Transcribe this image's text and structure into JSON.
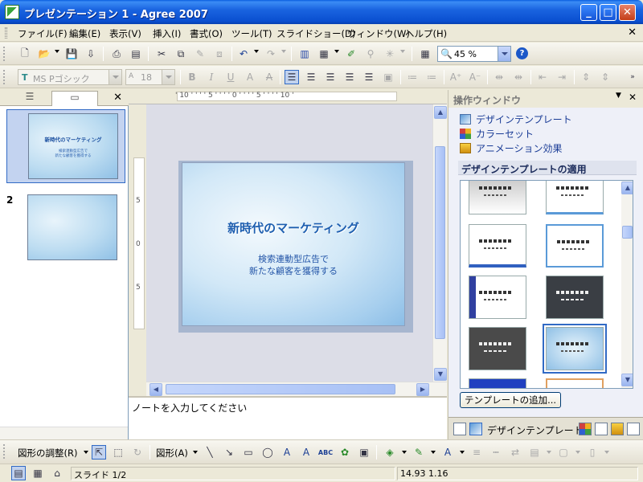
{
  "window": {
    "title": "プレゼンテーション 1 - Agree 2007"
  },
  "menu": {
    "items": [
      "ファイル(F)",
      "編集(E)",
      "表示(V)",
      "挿入(I)",
      "書式(O)",
      "ツール(T)",
      "スライドショー(D)",
      "ウィンドウ(W)",
      "ヘルプ(H)"
    ]
  },
  "toolbar": {
    "zoom": "45 %"
  },
  "format_toolbar": {
    "font_name": "MS Pゴシック",
    "font_size": "18"
  },
  "slide_panel": {
    "slides": [
      {
        "number": "1",
        "title": "新時代のマーケティング",
        "subtitle_line1": "検索連動型広告で",
        "subtitle_line2": "新たな顧客を獲得する"
      },
      {
        "number": "2"
      }
    ]
  },
  "editor": {
    "ruler_h": "' 10 ' ' ' ' 5 ' ' ' ' 0 ' ' ' ' 5 ' ' ' ' 10 '",
    "ruler_v": [
      "5",
      "0",
      "5"
    ],
    "slide": {
      "title": "新時代のマーケティング",
      "subtitle_line1": "検索連動型広告で",
      "subtitle_line2": "新たな顧客を獲得する"
    },
    "notes_placeholder": "ノートを入力してください"
  },
  "task_pane": {
    "title": "操作ウィンドウ",
    "links": [
      "デザインテンプレート",
      "カラーセット",
      "アニメーション効果"
    ],
    "section_title": "デザインテンプレートの適用",
    "add_template_button": "テンプレートの追加...",
    "bottom_label": "デザインテンプレート"
  },
  "draw_toolbar": {
    "adjust_label": "図形の調整(R)",
    "shapes_label": "図形(A)"
  },
  "status": {
    "slide_info": "スライド 1/2",
    "coords": "14.93 1.16"
  },
  "colors": {
    "title_bar": "#0a4fd0",
    "slide_title": "#1e5fb0",
    "selection": "#316ac5"
  }
}
